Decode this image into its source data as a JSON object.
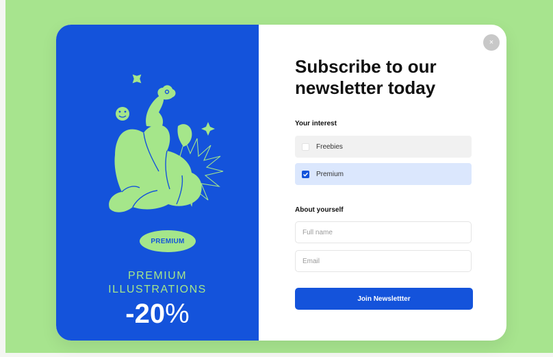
{
  "promo": {
    "badge": "PREMIUM",
    "title_line1": "PREMIUM",
    "title_line2": "ILLUSTRATIONS",
    "discount_number": "-20",
    "discount_symbol": "%"
  },
  "form": {
    "close_symbol": "×",
    "heading_line1": "Subscribe to our",
    "heading_line2": "newsletter today",
    "interest_label": "Your interest",
    "options": [
      {
        "label": "Freebies",
        "checked": false
      },
      {
        "label": "Premium",
        "checked": true
      }
    ],
    "about_label": "About yourself",
    "full_name_placeholder": "Full name",
    "email_placeholder": "Email",
    "submit_label": "Join Newslettter"
  },
  "colors": {
    "background": "#a7e48e",
    "promo_blue": "#1453db",
    "accent_green": "#a5e68a",
    "selected_option": "#dbe7fd"
  },
  "icons": [
    "sparkle-icon",
    "star-icon",
    "smiley-icon",
    "flower-icon",
    "burst-icon",
    "close-icon",
    "checkbox-checked-icon",
    "checkbox-empty-icon"
  ]
}
